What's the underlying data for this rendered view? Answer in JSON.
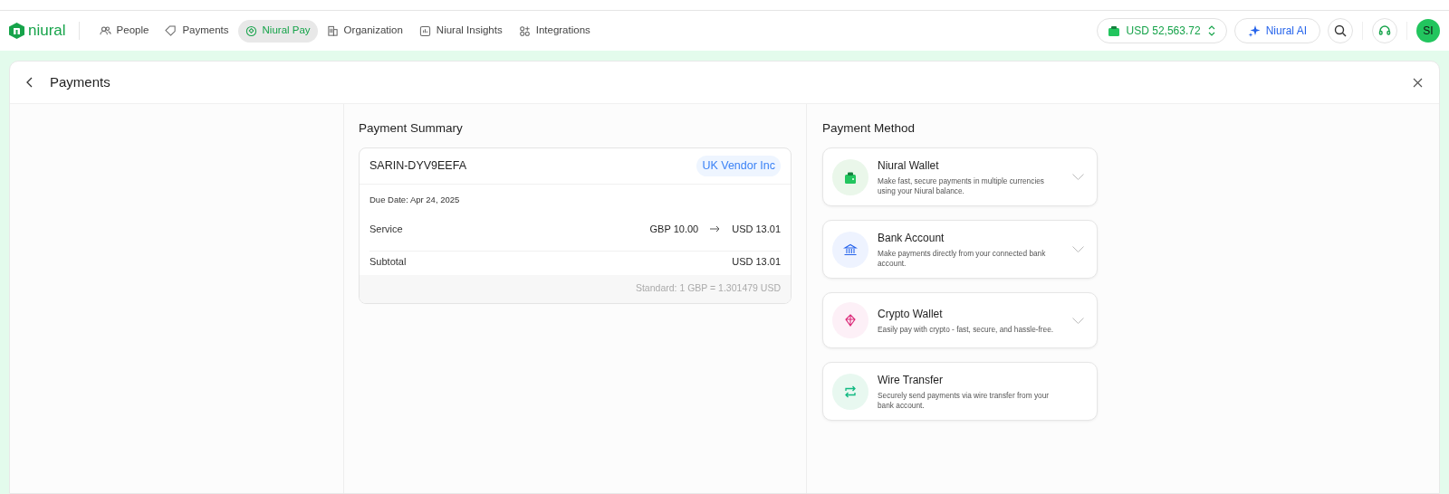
{
  "brand": {
    "name": "niural"
  },
  "nav": [
    {
      "label": "People",
      "kind": "people",
      "selected": false
    },
    {
      "label": "Payments",
      "kind": "payments",
      "selected": false
    },
    {
      "label": "Niural Pay",
      "kind": "pay",
      "selected": true
    },
    {
      "label": "Organization",
      "kind": "organization",
      "selected": false
    },
    {
      "label": "Niural Insights",
      "kind": "insights",
      "selected": false
    },
    {
      "label": "Integrations",
      "kind": "integrations",
      "selected": false
    }
  ],
  "balance": "USD 52,563.72",
  "ai_button": "Niural AI",
  "avatar": "SI",
  "page_title": "Payments",
  "summary": {
    "heading": "Payment Summary",
    "reference": "SARIN-DYV9EEFA",
    "vendor": "UK Vendor Inc",
    "due_date": "Due Date: Apr 24, 2025",
    "rows": [
      {
        "label": "Service",
        "from": "GBP 10.00",
        "to": "USD 13.01"
      },
      {
        "label": "Subtotal",
        "to": "USD 13.01"
      }
    ],
    "rate": "Standard: 1 GBP = 1.301479 USD"
  },
  "methods_heading": "Payment Method",
  "methods": [
    {
      "kind": "wallet",
      "title": "Niural Wallet",
      "description": "Make fast, secure payments in multiple currencies using your Niural balance.",
      "expandable": true
    },
    {
      "kind": "bank",
      "title": "Bank Account",
      "description": "Make payments directly from your connected bank account.",
      "expandable": true
    },
    {
      "kind": "crypto",
      "title": "Crypto Wallet",
      "description": "Easily pay with crypto - fast, secure, and hassle-free.",
      "expandable": true
    },
    {
      "kind": "wire",
      "title": "Wire Transfer",
      "description": "Securely send payments via wire transfer from your bank account.",
      "expandable": false
    }
  ]
}
